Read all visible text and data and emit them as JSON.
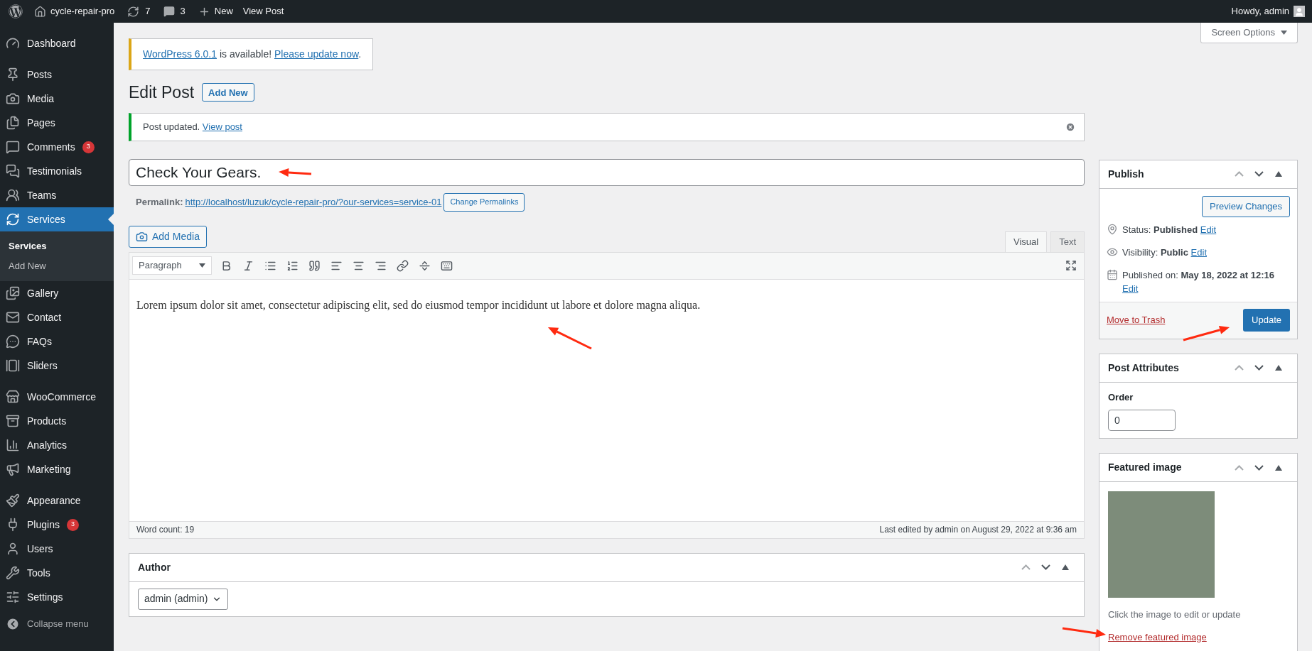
{
  "admin_bar": {
    "site_name": "cycle-repair-pro",
    "updates_count": "7",
    "comments_count": "3",
    "new_label": "New",
    "view_label": "View Post",
    "greeting": "Howdy, admin"
  },
  "sidebar": {
    "groups": [
      [
        {
          "label": "Dashboard",
          "selected": false
        }
      ],
      [
        {
          "label": "Posts",
          "selected": false
        },
        {
          "label": "Media",
          "selected": false
        },
        {
          "label": "Pages",
          "selected": false
        },
        {
          "label": "Comments",
          "selected": false,
          "badge": "3"
        },
        {
          "label": "Testimonials",
          "selected": false
        },
        {
          "label": "Teams",
          "selected": false
        },
        {
          "label": "Services",
          "selected": true,
          "children": [
            {
              "label": "Services",
              "selected": true
            },
            {
              "label": "Add New",
              "selected": false
            }
          ]
        },
        {
          "label": "Gallery",
          "selected": false
        },
        {
          "label": "Contact",
          "selected": false
        },
        {
          "label": "FAQs",
          "selected": false
        },
        {
          "label": "Sliders",
          "selected": false
        }
      ],
      [
        {
          "label": "WooCommerce",
          "selected": false
        },
        {
          "label": "Products",
          "selected": false
        },
        {
          "label": "Analytics",
          "selected": false
        },
        {
          "label": "Marketing",
          "selected": false
        }
      ],
      [
        {
          "label": "Appearance",
          "selected": false
        },
        {
          "label": "Plugins",
          "selected": false,
          "badge": "3"
        },
        {
          "label": "Users",
          "selected": false
        },
        {
          "label": "Tools",
          "selected": false
        },
        {
          "label": "Settings",
          "selected": false
        }
      ]
    ],
    "collapse_label": "Collapse menu"
  },
  "screen_options": "Screen Options",
  "update_notice": {
    "version_link": "WordPress 6.0.1",
    "text": "is available!",
    "action_link": "Please update now",
    "end": "."
  },
  "heading": "Edit Post",
  "add_new": "Add New",
  "success_notice": {
    "text": "Post updated.",
    "link": "View post"
  },
  "title_field": {
    "value": "Check Your Gears."
  },
  "permalink": {
    "label": "Permalink:",
    "url": "http://localhost/luzuk/cycle-repair-pro/?our-services=service-01",
    "button": "Change Permalinks"
  },
  "add_media": "Add Media",
  "editor_tabs": [
    {
      "label": "Visual",
      "selected": true
    },
    {
      "label": "Text",
      "selected": false
    }
  ],
  "format_select": "Paragraph",
  "content": "Lorem ipsum dolor sit amet, consectetur adipiscing elit, sed do eiusmod tempor incididunt ut labore et dolore magna aliqua.",
  "word_count": "Word count: 19",
  "last_edited": "Last edited by admin on August 29, 2022 at 9:36 am",
  "author_box": {
    "title": "Author",
    "value": "admin (admin)"
  },
  "publish_box": {
    "title": "Publish",
    "preview_button": "Preview Changes",
    "rows": [
      {
        "text": "Status: **Published**",
        "link": "Edit"
      },
      {
        "text": "Visibility: **Public**",
        "link": "Edit"
      },
      {
        "text": "Published on: **May 18, 2022 at 12:16**",
        "link": "Edit"
      }
    ],
    "trash_link": "Move to Trash",
    "update_button": "Update"
  },
  "attributes_box": {
    "title": "Post Attributes",
    "order_label": "Order",
    "order_value": "0"
  },
  "featured_box": {
    "title": "Featured image",
    "hint": "Click the image to edit or update",
    "remove_link": "Remove featured image"
  }
}
